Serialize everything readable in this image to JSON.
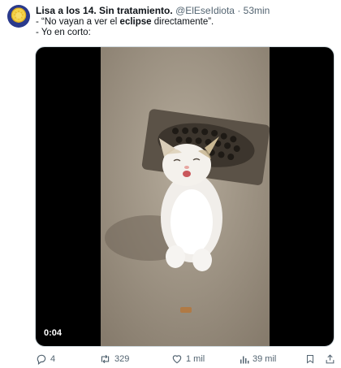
{
  "tweet": {
    "author_name": "Lisa a los 14. Sin tratamiento.",
    "author_handle": "@ElEseIdiota",
    "separator": "·",
    "time": "53min",
    "text_line1_prefix": "- “No vayan a ver el ",
    "text_line1_bold": "eclipse",
    "text_line1_suffix": " directamente”.",
    "text_line2": "- Yo en corto:"
  },
  "media": {
    "duration": "0:04"
  },
  "actions": {
    "replies": "4",
    "retweets": "329",
    "likes": "1 mil",
    "views": "39 mil"
  },
  "colors": {
    "text": "#0f1419",
    "secondary": "#536471",
    "border": "#cfd9de"
  }
}
